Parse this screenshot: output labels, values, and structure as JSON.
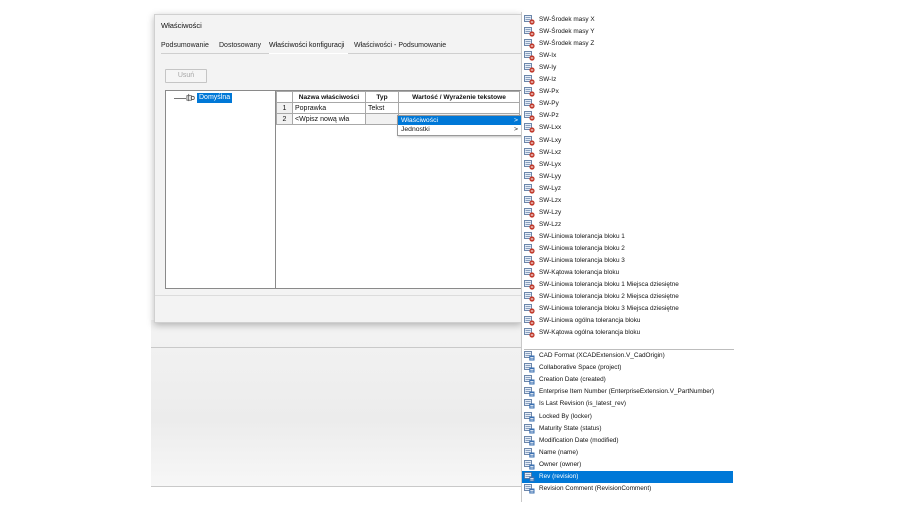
{
  "dialog": {
    "title": "Właściwości",
    "tabs": [
      {
        "label": "Podsumowanie"
      },
      {
        "label": "Dostosowany"
      },
      {
        "label": "Właściwości konfiguracji"
      },
      {
        "label": "Właściwości - Podsumowanie"
      }
    ],
    "active_tab": "Właściwości konfiguracji",
    "delete_button": "Usuń",
    "tree": {
      "label": "Domyślna"
    },
    "grid": {
      "headers": [
        "",
        "Nazwa właściwości",
        "Typ",
        "Wartość / Wyrażenie tekstowe"
      ],
      "rows": [
        {
          "num": "1",
          "name": "Poprawka",
          "type": "Tekst",
          "value": ""
        },
        {
          "num": "2",
          "name": "<Wpisz nową wła",
          "type": "",
          "value": ""
        }
      ]
    }
  },
  "context_menu": {
    "items": [
      {
        "label": "Właściwości",
        "arrow": ">"
      },
      {
        "label": "Jednostki",
        "arrow": ">"
      }
    ],
    "selected": "Właściwości"
  },
  "property_list": {
    "sw_items": [
      "SW-Środek masy X",
      "SW-Środek masy Y",
      "SW-Środek masy Z",
      "SW-Ix",
      "SW-Iy",
      "SW-Iz",
      "SW-Px",
      "SW-Py",
      "SW-Pz",
      "SW-Lxx",
      "SW-Lxy",
      "SW-Lxz",
      "SW-Lyx",
      "SW-Lyy",
      "SW-Lyz",
      "SW-Lzx",
      "SW-Lzy",
      "SW-Lzz",
      "SW-Liniowa tolerancja bloku 1",
      "SW-Liniowa tolerancja bloku 2",
      "SW-Liniowa tolerancja bloku 3",
      "SW-Kątowa tolerancja bloku",
      "SW-Liniowa tolerancja bloku 1 Miejsca dziesiętne",
      "SW-Liniowa tolerancja bloku 2 Miejsca dziesiętne",
      "SW-Liniowa tolerancja bloku 3 Miejsca dziesiętne",
      "SW-Liniowa ogólna tolerancja bloku",
      "SW-Kątowa ogólna tolerancja bloku"
    ],
    "ext_items": [
      "CAD Format (XCADExtension.V_CadOrigin)",
      "Collaborative Space (project)",
      "Creation Date (created)",
      "Enterprise Item Number (EnterpriseExtension.V_PartNumber)",
      "Is Last Revision (is_latest_rev)",
      "Locked By (locker)",
      "Maturity State (status)",
      "Modification Date (modified)",
      "Name (name)",
      "Owner (owner)",
      "Rev (revision)",
      "Revision Comment (RevisionComment)"
    ],
    "selected": "Rev (revision)"
  },
  "colors": {
    "selection": "#0078d7",
    "sw_icon_red": "#c0392b",
    "ext_icon_blue": "#3a6fb0"
  },
  "icons": {
    "sw_items": "sw-property-icon",
    "ext_items": "3dx-property-icon",
    "tree": "configuration-icon"
  }
}
